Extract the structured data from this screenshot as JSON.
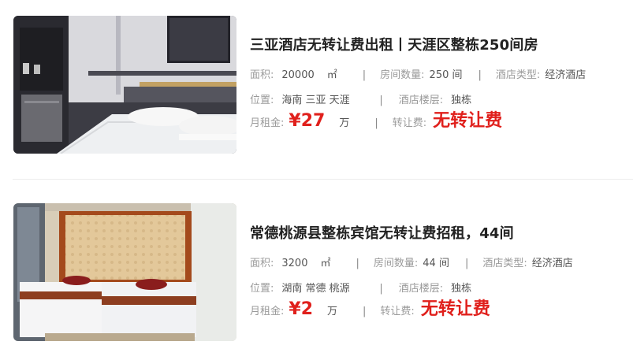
{
  "listings": [
    {
      "title": "三亚酒店无转让费出租丨天涯区整栋250间房",
      "area_label": "面积:",
      "area_value": "20000",
      "area_unit": "㎡",
      "rooms_label": "房间数量:",
      "rooms_value": "250 间",
      "type_label": "酒店类型:",
      "type_value": "经济酒店",
      "location_label": "位置:",
      "location_value": "海南 三亚 天涯",
      "floor_label": "酒店楼层:",
      "floor_value": "独栋",
      "rent_label": "月租金:",
      "rent_value": "¥27",
      "rent_unit": "万",
      "transfer_label": "转让费:",
      "transfer_value": "无转让费",
      "thumb_icon": "hotel-room-photo"
    },
    {
      "title": "常德桃源县整栋宾馆无转让费招租，44间",
      "area_label": "面积:",
      "area_value": "3200",
      "area_unit": "㎡",
      "rooms_label": "房间数量:",
      "rooms_value": "44 间",
      "type_label": "酒店类型:",
      "type_value": "经济酒店",
      "location_label": "位置:",
      "location_value": "湖南 常德 桃源",
      "floor_label": "酒店楼层:",
      "floor_value": "独栋",
      "rent_label": "月租金:",
      "rent_value": "¥2",
      "rent_unit": "万",
      "transfer_label": "转让费:",
      "transfer_value": "无转让费",
      "thumb_icon": "hotel-room-photo"
    }
  ],
  "separator": "|",
  "colors": {
    "accent_red": "#e0201c",
    "label_gray": "#9a9a9a",
    "value_gray": "#555555",
    "title": "#222222",
    "divider": "#ececec"
  }
}
